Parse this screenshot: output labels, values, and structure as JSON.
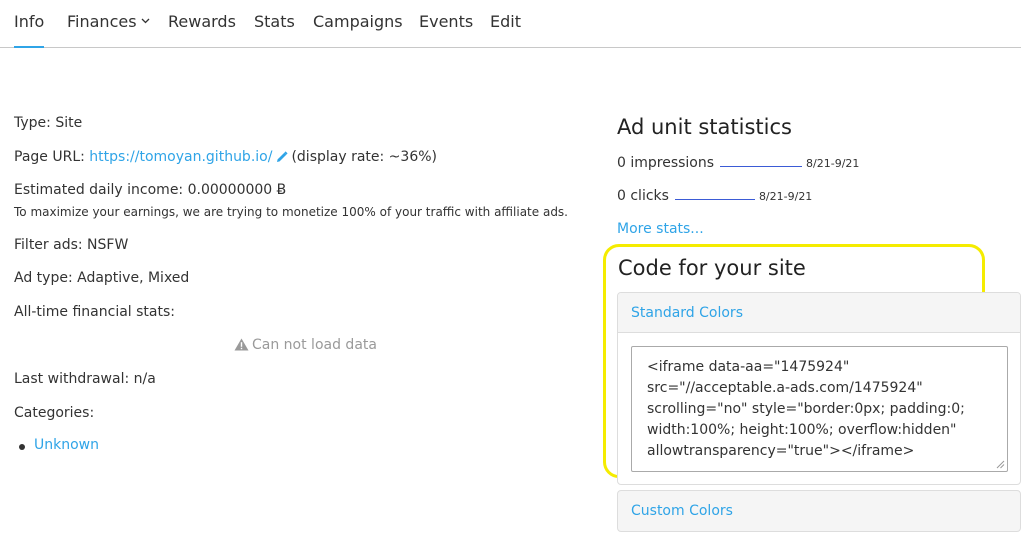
{
  "nav": {
    "tabs": [
      "Info",
      "Finances",
      "Rewards",
      "Stats",
      "Campaigns",
      "Events",
      "Edit"
    ],
    "active": "Info"
  },
  "info": {
    "type": "Type: Site",
    "page_url_label": "Page URL:",
    "page_url": "https://tomoyan.github.io/",
    "display_rate": "(display rate: ~36%)",
    "daily_income": "Estimated daily income: 0.00000000 Ƀ",
    "monetize_note": "To maximize your earnings, we are trying to monetize 100% of your traffic with affiliate ads.",
    "filter_ads": "Filter ads: NSFW",
    "ad_type": "Ad type: Adaptive, Mixed",
    "financial_stats": "All-time financial stats:",
    "load_error": "Can not load data",
    "last_withdrawal": "Last withdrawal: n/a",
    "categories_label": "Categories:",
    "categories": [
      "Unknown"
    ]
  },
  "stats": {
    "title": "Ad unit statistics",
    "impressions": "0 impressions",
    "impressions_range": "8/21-9/21",
    "clicks": "0 clicks",
    "clicks_range": "8/21-9/21",
    "more_link": "More stats...",
    "sparkline_color": "#3b5bd6"
  },
  "code": {
    "title": "Code for your site",
    "standard_label": "Standard Colors",
    "snippet": "<iframe data-aa=\"1475924\" src=\"//acceptable.a-ads.com/1475924\" scrolling=\"no\" style=\"border:0px; padding:0; width:100%; height:100%; overflow:hidden\" allowtransparency=\"true\"></iframe>",
    "custom_label": "Custom Colors",
    "highlight_color": "#f5ec00"
  },
  "colors": {
    "accent": "#2fa4e7",
    "text": "#333333"
  }
}
